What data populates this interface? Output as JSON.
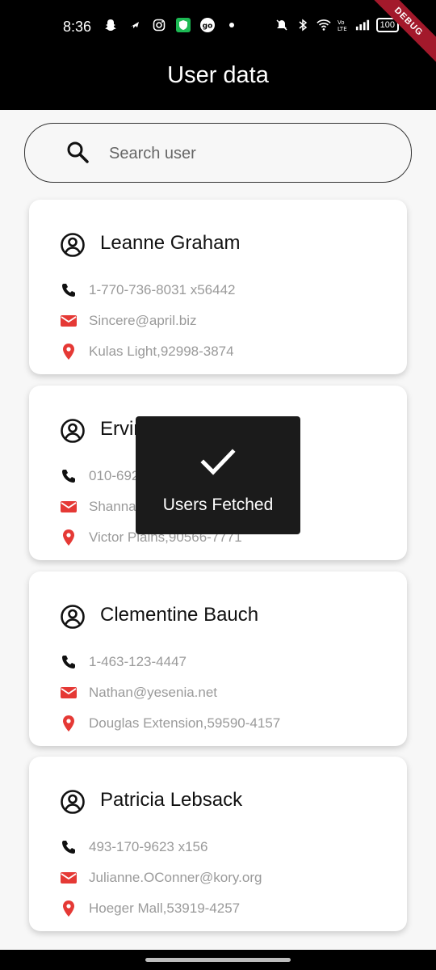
{
  "status_bar": {
    "time": "8:36",
    "battery": "100",
    "left_icons": [
      "snapchat-icon",
      "airplane-icon",
      "instagram-icon",
      "shield-icon",
      "go-icon",
      "dot-icon"
    ],
    "right_icons": [
      "mute-icon",
      "bluetooth-icon",
      "wifi-icon",
      "volte-icon",
      "signal-icon",
      "battery-icon"
    ]
  },
  "debug_banner": "DEBUG",
  "app_bar": {
    "title": "User data"
  },
  "search": {
    "placeholder": "Search user",
    "value": ""
  },
  "colors": {
    "accent_icon": "#e53935",
    "card_bg": "#ffffff",
    "toast_bg": "#1b1b1b"
  },
  "users": [
    {
      "name": "Leanne Graham",
      "phone": "1-770-736-8031 x56442",
      "email": "Sincere@april.biz",
      "address": "Kulas Light,92998-3874"
    },
    {
      "name": "Ervin Howell",
      "phone": "010-692-6593 x09125",
      "email": "Shanna@melissa.tv",
      "address": "Victor Plains,90566-7771"
    },
    {
      "name": "Clementine Bauch",
      "phone": "1-463-123-4447",
      "email": "Nathan@yesenia.net",
      "address": "Douglas Extension,59590-4157"
    },
    {
      "name": "Patricia Lebsack",
      "phone": "493-170-9623 x156",
      "email": "Julianne.OConner@kory.org",
      "address": "Hoeger Mall,53919-4257"
    }
  ],
  "toast": {
    "message": "Users Fetched",
    "icon": "check-icon"
  }
}
